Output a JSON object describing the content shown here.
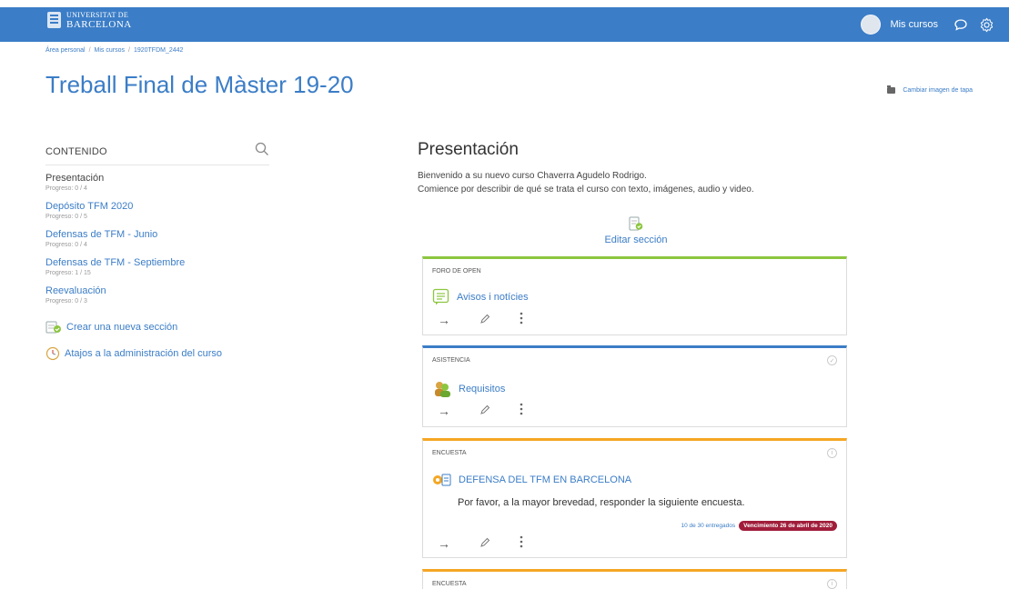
{
  "navbar": {
    "logo_line1": "UNIVERSITAT DE",
    "logo_line2": "BARCELONA",
    "mis_cursos": "Mis cursos"
  },
  "breadcrumb": [
    "Área personal",
    "Mis cursos",
    "1920TFDM_2442"
  ],
  "course": {
    "title": "Treball Final de Màster 19-20",
    "change_cover": "Cambiar imagen de tapa"
  },
  "sidebar": {
    "heading": "CONTENIDO",
    "sections": [
      {
        "name": "Presentación",
        "progress": "Progreso: 0 / 4"
      },
      {
        "name": "Depósito TFM 2020",
        "progress": "Progreso: 0 / 5"
      },
      {
        "name": "Defensas de TFM - Junio",
        "progress": "Progreso: 0 / 4"
      },
      {
        "name": "Defensas de TFM - Septiembre",
        "progress": "Progreso: 1 / 15"
      },
      {
        "name": "Reevaluación",
        "progress": "Progreso: 0 / 3"
      }
    ],
    "create_section": "Crear una nueva sección",
    "admin_shortcuts": "Atajos a la administración del curso"
  },
  "main": {
    "section_title": "Presentación",
    "summary_line1": "Bienvenido a su nuevo curso Chaverra Agudelo Rodrigo.",
    "summary_line2": "Comience por describir de qué se trata el curso con texto, imágenes, audio y video.",
    "edit_section": "Editar sección",
    "activities": [
      {
        "type": "FORO DE OPEN",
        "name": "Avisos i notícies",
        "accent": "#8cc63f",
        "icon": "forum-icon"
      },
      {
        "type": "ASISTENCIA",
        "name": "Requisitos",
        "accent": "#3b7dc7",
        "icon": "attendance-icon",
        "status": "✓"
      },
      {
        "type": "ENCUESTA",
        "name": "DEFENSA DEL TFM EN BARCELONA",
        "accent": "#f5a623",
        "icon": "survey-icon",
        "status": "i",
        "description": "Por favor, a la mayor brevedad, responder la siguiente encuesta.",
        "submitted": "10 de 30 entregados",
        "due": "Vencimiento 26 de abril de 2020"
      },
      {
        "type": "ENCUESTA",
        "accent": "#f5a623",
        "status": "i"
      }
    ]
  },
  "colors": {
    "brand": "#3b7dc7",
    "due_badge": "#a01d3a"
  }
}
